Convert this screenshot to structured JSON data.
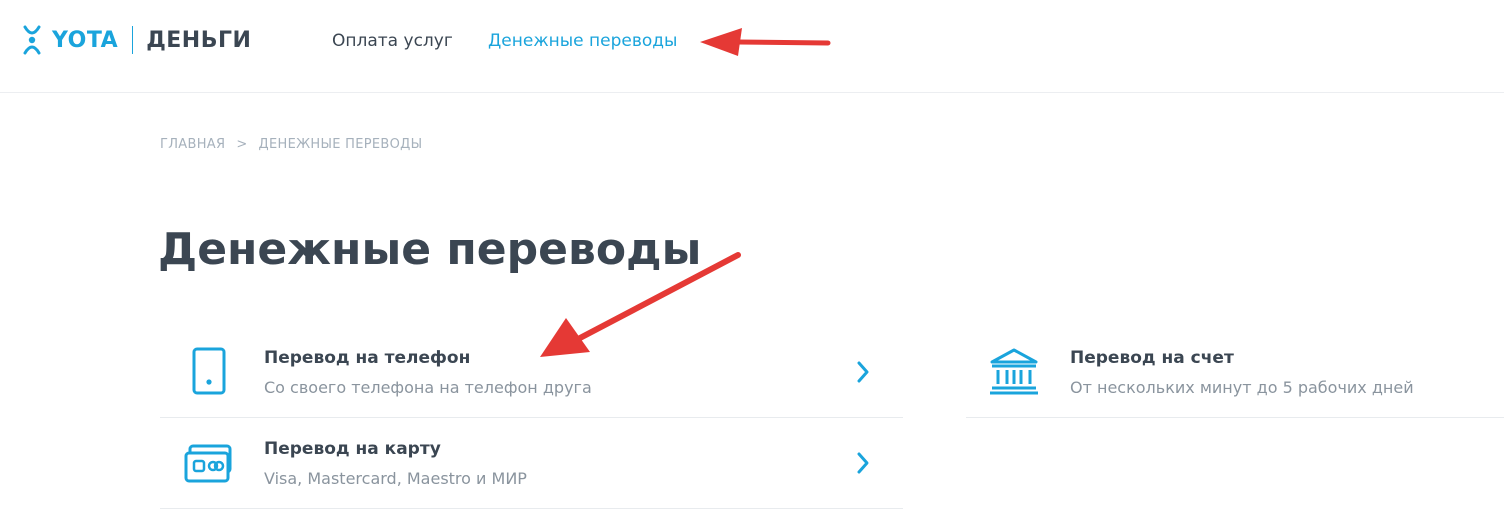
{
  "header": {
    "logo_brand": "YOTA",
    "logo_product": "ДЕНЬГИ",
    "nav": {
      "payments": "Оплата услуг",
      "transfers": "Денежные переводы"
    }
  },
  "breadcrumb": {
    "home": "ГЛАВНАЯ",
    "separator": ">",
    "current": "ДЕНЕЖНЫЕ ПЕРЕВОДЫ"
  },
  "page_title": "Денежные переводы",
  "cards": {
    "phone": {
      "title": "Перевод на телефон",
      "subtitle": "Со своего телефона на телефон друга",
      "icon": "phone-icon"
    },
    "card": {
      "title": "Перевод на карту",
      "subtitle": "Visa, Mastercard, Maestro и МИР",
      "icon": "bank-card-icon"
    },
    "account": {
      "title": "Перевод на счет",
      "subtitle": "От нескольких минут до 5 рабочих дней",
      "icon": "bank-building-icon"
    }
  },
  "colors": {
    "accent": "#1aa4dc",
    "text": "#3b4652",
    "muted": "#8a949e",
    "annotation_arrow": "#e53935"
  }
}
